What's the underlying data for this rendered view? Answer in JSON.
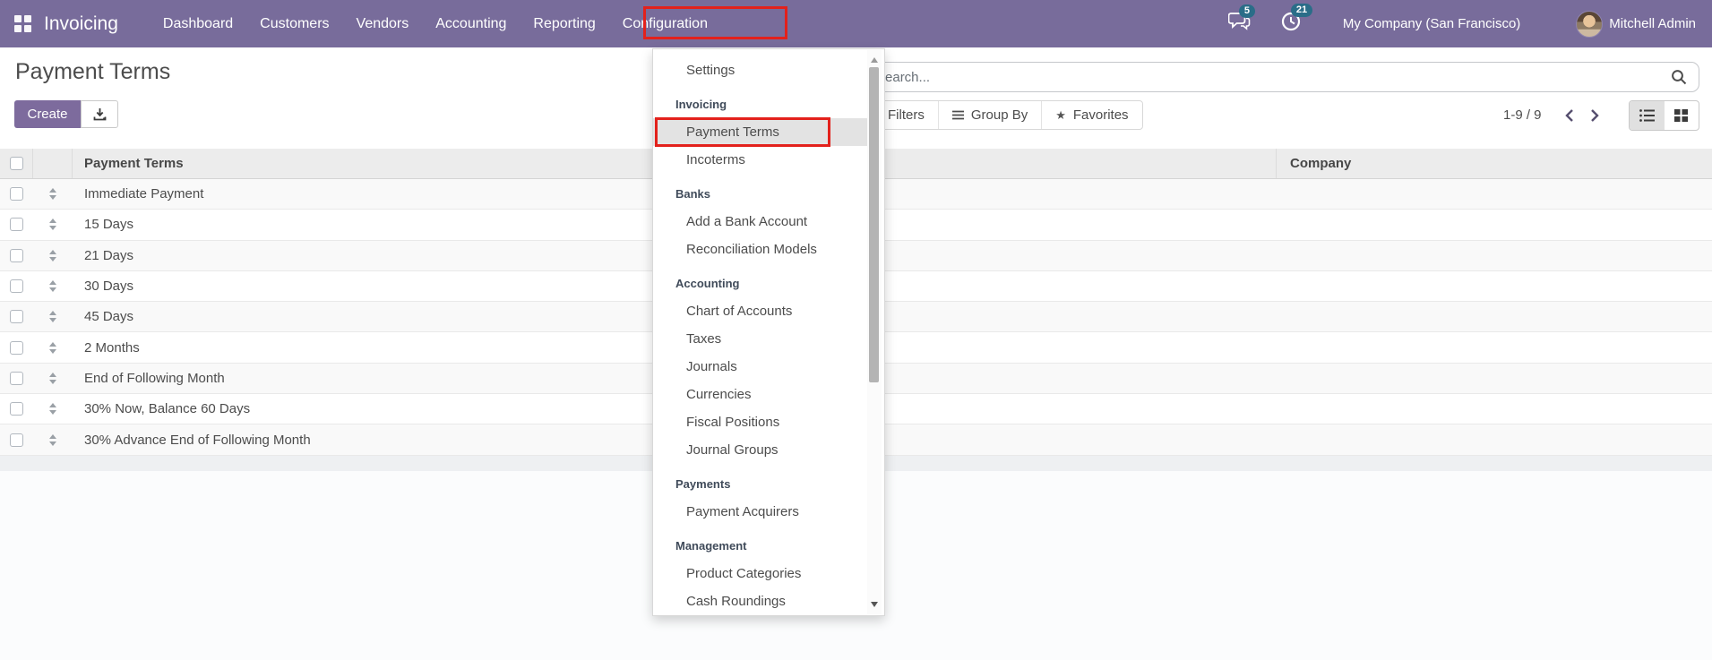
{
  "app": {
    "brand": "Invoicing"
  },
  "nav": {
    "items": [
      {
        "label": "Dashboard",
        "active": false
      },
      {
        "label": "Customers",
        "active": false
      },
      {
        "label": "Vendors",
        "active": false
      },
      {
        "label": "Accounting",
        "active": false
      },
      {
        "label": "Reporting",
        "active": false
      },
      {
        "label": "Configuration",
        "active": true
      }
    ]
  },
  "topbar": {
    "messages_count": "5",
    "activities_count": "21",
    "company": "My Company (San Francisco)",
    "user": "Mitchell Admin"
  },
  "page": {
    "title": "Payment Terms"
  },
  "toolbar": {
    "create_label": "Create"
  },
  "search": {
    "placeholder": "Search...",
    "value": ""
  },
  "controls": {
    "filters_label": "Filters",
    "group_by_label": "Group By",
    "favorites_label": "Favorites",
    "pager_range": "1-9 / 9"
  },
  "table": {
    "columns": [
      "Payment Terms",
      "Company"
    ],
    "rows": [
      {
        "name": "Immediate Payment",
        "company": ""
      },
      {
        "name": "15 Days",
        "company": ""
      },
      {
        "name": "21 Days",
        "company": ""
      },
      {
        "name": "30 Days",
        "company": ""
      },
      {
        "name": "45 Days",
        "company": ""
      },
      {
        "name": "2 Months",
        "company": ""
      },
      {
        "name": "End of Following Month",
        "company": ""
      },
      {
        "name": "30% Now, Balance 60 Days",
        "company": ""
      },
      {
        "name": "30% Advance End of Following Month",
        "company": ""
      }
    ]
  },
  "config_menu": {
    "items": [
      {
        "type": "item",
        "label": "Settings",
        "highlighted": false
      },
      {
        "type": "section",
        "label": "Invoicing"
      },
      {
        "type": "item",
        "label": "Payment Terms",
        "highlighted": true
      },
      {
        "type": "item",
        "label": "Incoterms",
        "highlighted": false
      },
      {
        "type": "section",
        "label": "Banks"
      },
      {
        "type": "item",
        "label": "Add a Bank Account",
        "highlighted": false
      },
      {
        "type": "item",
        "label": "Reconciliation Models",
        "highlighted": false
      },
      {
        "type": "section",
        "label": "Accounting"
      },
      {
        "type": "item",
        "label": "Chart of Accounts",
        "highlighted": false
      },
      {
        "type": "item",
        "label": "Taxes",
        "highlighted": false
      },
      {
        "type": "item",
        "label": "Journals",
        "highlighted": false
      },
      {
        "type": "item",
        "label": "Currencies",
        "highlighted": false
      },
      {
        "type": "item",
        "label": "Fiscal Positions",
        "highlighted": false
      },
      {
        "type": "item",
        "label": "Journal Groups",
        "highlighted": false
      },
      {
        "type": "section",
        "label": "Payments"
      },
      {
        "type": "item",
        "label": "Payment Acquirers",
        "highlighted": false
      },
      {
        "type": "section",
        "label": "Management"
      },
      {
        "type": "item",
        "label": "Product Categories",
        "highlighted": false
      },
      {
        "type": "item",
        "label": "Cash Roundings",
        "highlighted": false
      }
    ]
  },
  "icons": {
    "apps": "grid-2x2-squares",
    "messages": "chat-bubbles",
    "activities": "clock",
    "export": "download-arrow-tray",
    "search": "magnifier",
    "group_by": "hamburger-lines",
    "favorites": "star",
    "list_view": "list-lines",
    "kanban_view": "grid-squares",
    "row_drag": "up-down-triangles",
    "pager_prev": "chevron-left",
    "pager_next": "chevron-right"
  },
  "colors": {
    "topbar": "#786c9b",
    "primary_button": "#7d6b9d",
    "annotation_red": "#e3211c",
    "badge": "#2a6d88",
    "menu_highlight": "#e3e3e3",
    "table_header_bg": "#ececec"
  }
}
